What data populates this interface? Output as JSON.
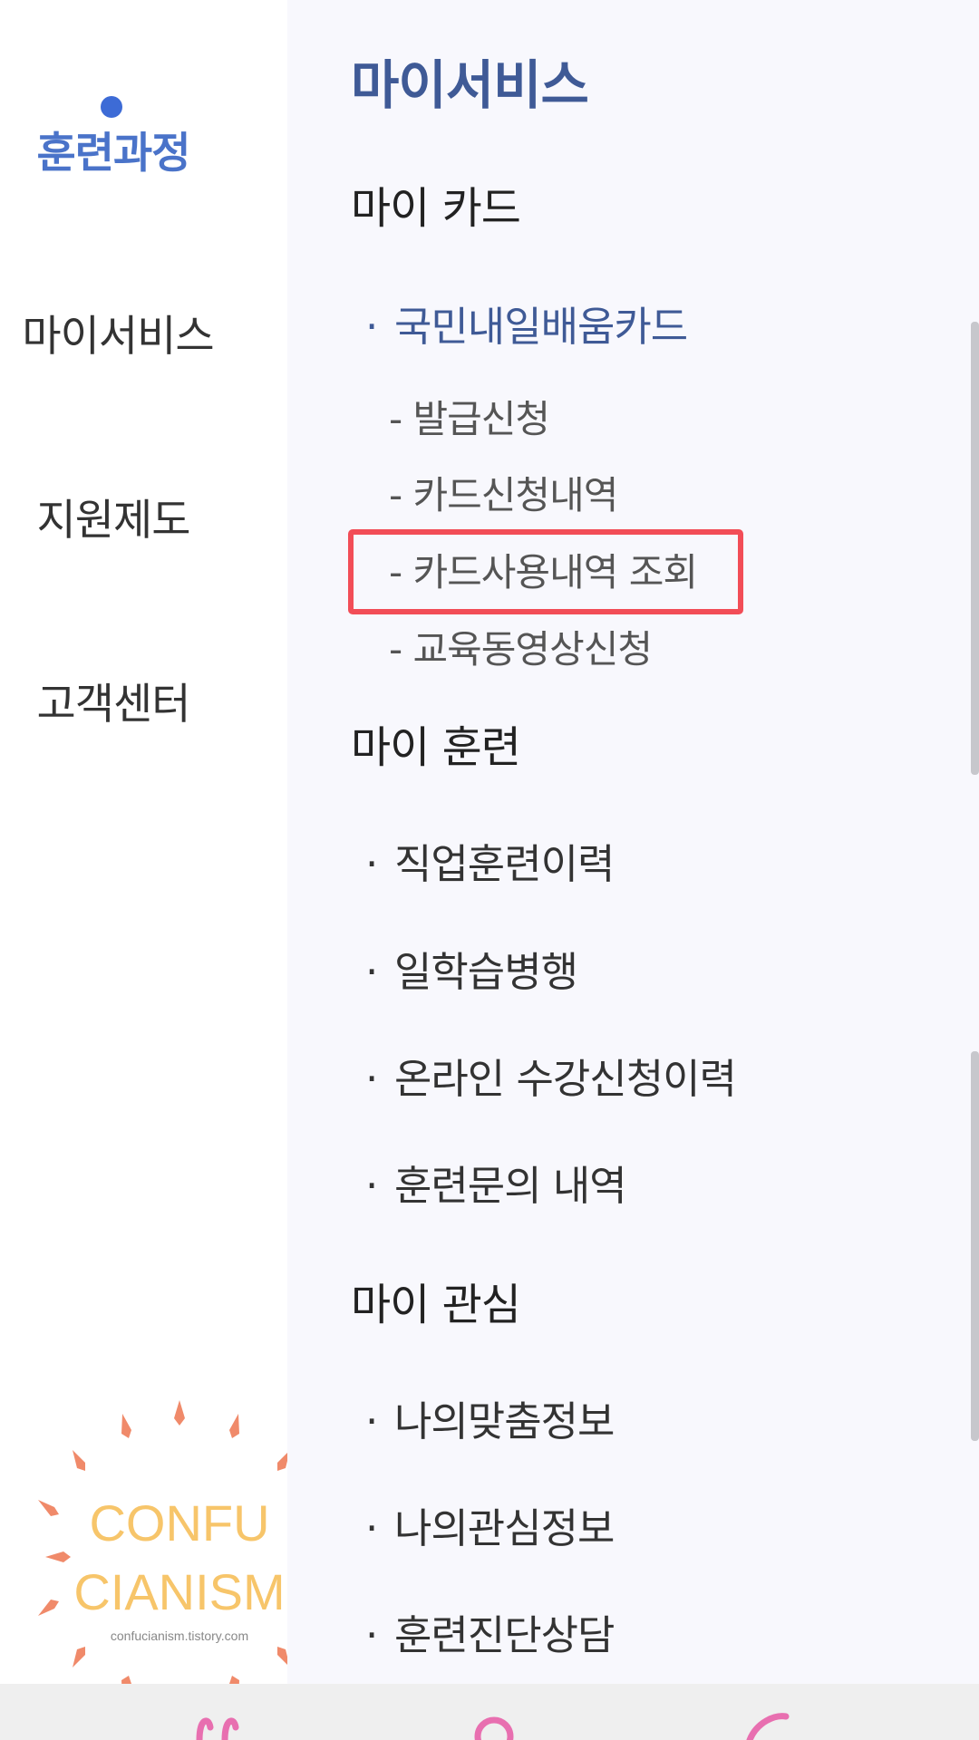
{
  "left_nav": {
    "items": [
      {
        "label": "훈련과정",
        "active": true
      },
      {
        "label": "마이서비스",
        "active": false
      },
      {
        "label": "지원제도",
        "active": false
      },
      {
        "label": "고객센터",
        "active": false
      }
    ]
  },
  "panel": {
    "title": "마이서비스",
    "sections": [
      {
        "title": "마이 카드",
        "items": [
          {
            "label": "국민내일배움카드",
            "bullet": "·",
            "subitems": [
              {
                "label": "- 발급신청"
              },
              {
                "label": "- 카드신청내역"
              },
              {
                "label": "- 카드사용내역 조회",
                "highlighted": true
              },
              {
                "label": "- 교육동영상신청"
              }
            ]
          }
        ]
      },
      {
        "title": "마이 훈련",
        "items": [
          {
            "label": "직업훈련이력",
            "bullet": "·"
          },
          {
            "label": "일학습병행",
            "bullet": "·"
          },
          {
            "label": "온라인 수강신청이력",
            "bullet": "·"
          },
          {
            "label": "훈련문의 내역",
            "bullet": "·"
          }
        ]
      },
      {
        "title": "마이 관심",
        "items": [
          {
            "label": "나의맞춤정보",
            "bullet": "·"
          },
          {
            "label": "나의관심정보",
            "bullet": "·"
          },
          {
            "label": "훈련진단상담",
            "bullet": "·"
          }
        ]
      }
    ]
  },
  "watermark": {
    "line1": "CONFU",
    "line2": "CIANISM",
    "url": "confucianism.tistory.com"
  },
  "colors": {
    "accent_blue": "#4a73c9",
    "title_blue": "#3f5a96",
    "highlight_red": "#f24d57",
    "panel_bg": "#f8f8fd"
  },
  "icons": [
    "bullet-dot-icon",
    "watermark-logo",
    "bottom-tab-icon"
  ]
}
